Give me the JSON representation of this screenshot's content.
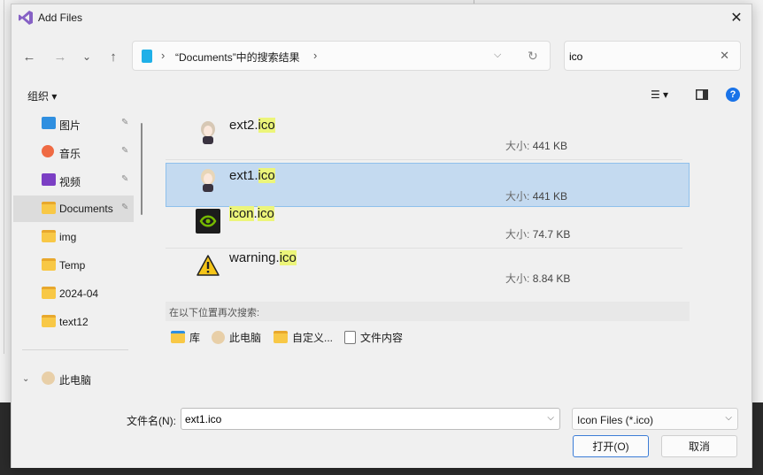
{
  "window": {
    "title": "Add Files",
    "close_glyph": "✕"
  },
  "nav": {
    "back": "←",
    "forward": "→",
    "recent": "⌄",
    "up": "↑"
  },
  "address": {
    "sep": "›",
    "crumb": "“Documents”中的搜索结果",
    "dropdown": "⌵",
    "refresh": "↻"
  },
  "search": {
    "value": "ico",
    "clear": "✕"
  },
  "toolbar": {
    "organize": "组织 ▾",
    "view": "☰ ▾",
    "help": "?"
  },
  "sidebar": {
    "items": [
      {
        "label": "图片",
        "icon": "pictures-icon",
        "pinned": true
      },
      {
        "label": "音乐",
        "icon": "music-icon",
        "pinned": true
      },
      {
        "label": "视频",
        "icon": "videos-icon",
        "pinned": true
      },
      {
        "label": "Documents",
        "icon": "folder-icon",
        "pinned": true
      },
      {
        "label": "img",
        "icon": "folder-icon"
      },
      {
        "label": "Temp",
        "icon": "folder-icon"
      },
      {
        "label": "2024-04",
        "icon": "folder-icon"
      },
      {
        "label": "text12",
        "icon": "folder-icon"
      }
    ],
    "pin_glyph": "📌",
    "this_pc": "此电脑",
    "expand": "⌄"
  },
  "files": [
    {
      "name_base": "ext2.",
      "name_match": "ico",
      "size_key": "大小:",
      "size": "441 KB",
      "icon": "anime-avatar-icon"
    },
    {
      "name_base": "ext1.",
      "name_match": "ico",
      "size_key": "大小:",
      "size": "441 KB",
      "icon": "anime-avatar-icon",
      "selected": true
    },
    {
      "name_base": "",
      "name_match": "icon",
      "name_rest": ".",
      "name_match2": "ico",
      "size_key": "大小:",
      "size": "74.7 KB",
      "icon": "nvidia-icon"
    },
    {
      "name_base": "warning.",
      "name_match": "ico",
      "size_key": "大小:",
      "size": "8.84 KB",
      "icon": "warning-icon"
    }
  ],
  "search_again": {
    "label": "在以下位置再次搜索:",
    "locations": [
      "库",
      "此电脑",
      "自定义...",
      "文件内容"
    ]
  },
  "bottom": {
    "filename_label": "文件名(N):",
    "filename_value": "ext1.ico",
    "filter_value": "Icon Files (*.ico)",
    "open_button": "打开(O)",
    "cancel_button": "取消",
    "dd": "⌵"
  },
  "colors": {
    "selection": "#c4daf0",
    "highlight": "#ecf57a",
    "accent": "#3a7bd5"
  }
}
